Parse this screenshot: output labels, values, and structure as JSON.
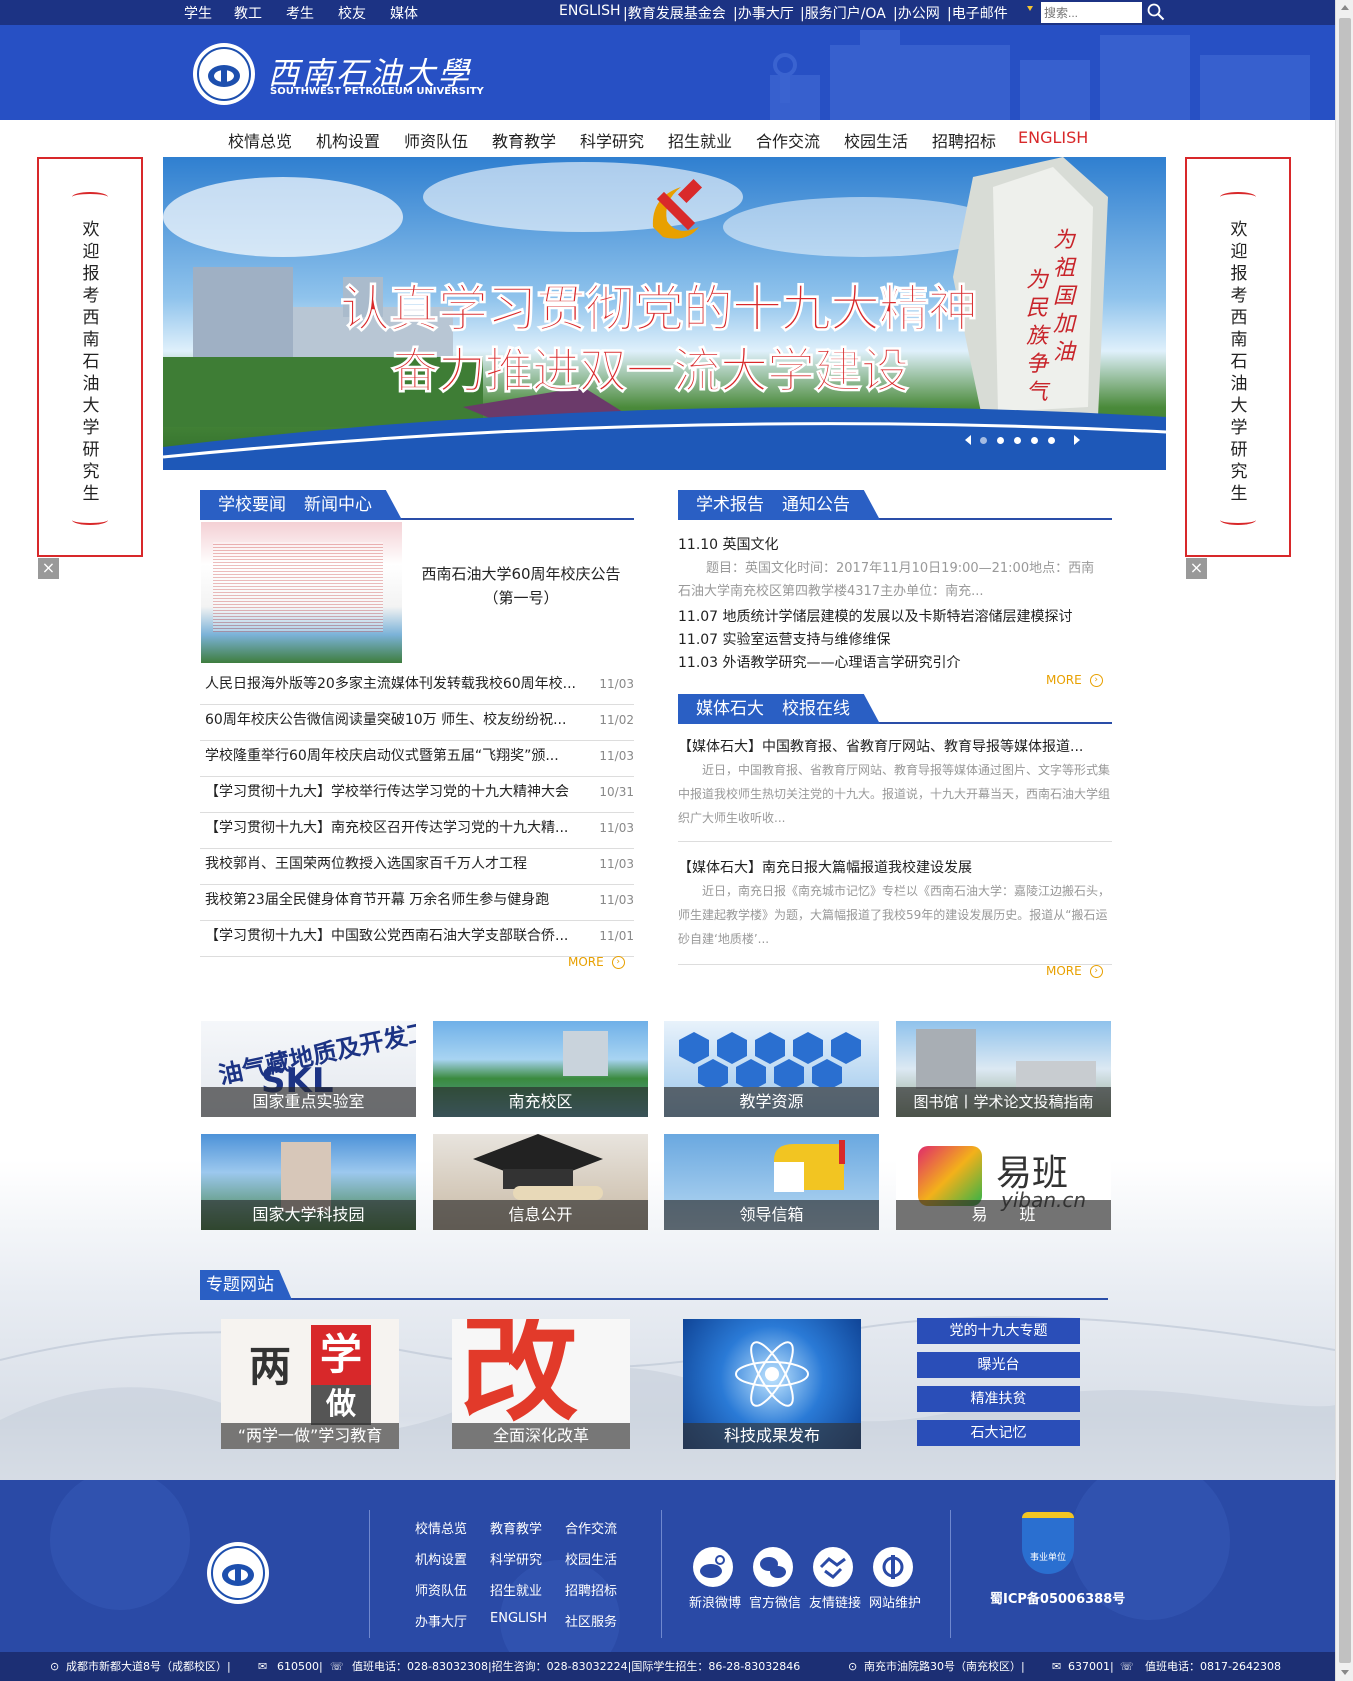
{
  "topbar": {
    "left_links": [
      "学生",
      "教工",
      "考生",
      "校友",
      "媒体"
    ],
    "right_links": [
      "ENGLISH",
      "|教育发展基金会",
      "|办事大厅",
      "|服务门户/OA",
      "|办公网",
      "|电子邮件"
    ],
    "search_placeholder": "搜索..."
  },
  "header": {
    "logo_cn": "西南石油大學",
    "logo_en": "SOUTHWEST PETROLEUM UNIVERSITY"
  },
  "nav": {
    "items": [
      "校情总览",
      "机构设置",
      "师资队伍",
      "教育教学",
      "科学研究",
      "招生就业",
      "合作交流",
      "校园生活",
      "招聘招标"
    ],
    "english": "ENGLISH"
  },
  "side_banner": {
    "text": "欢迎报考西南石油大学研究生",
    "close": "×"
  },
  "hero": {
    "line1": "认真学习贯彻党的十九大精神",
    "line2": "奋力推进双一流大学建设",
    "calligraphy": [
      "为祖国加油",
      "为民族争气"
    ]
  },
  "news": {
    "tab1": "学校要闻",
    "tab2": "新闻中心",
    "featured": "西南石油大学60周年校庆公告（第一号）",
    "more": "MORE",
    "items": [
      {
        "title": "人民日报海外版等20多家主流媒体刊发转载我校60周年校...",
        "date": "11/03"
      },
      {
        "title": "60周年校庆公告微信阅读量突破10万 师生、校友纷纷祝...",
        "date": "11/02"
      },
      {
        "title": "学校隆重举行60周年校庆启动仪式暨第五届“飞翔奖”颁...",
        "date": "11/03"
      },
      {
        "title": "【学习贯彻十九大】学校举行传达学习党的十九大精神大会",
        "date": "10/31"
      },
      {
        "title": "【学习贯彻十九大】南充校区召开传达学习党的十九大精...",
        "date": "11/03"
      },
      {
        "title": "我校郭肖、王国荣两位教授入选国家百千万人才工程",
        "date": "11/03"
      },
      {
        "title": "我校第23届全民健身体育节开幕 万余名师生参与健身跑",
        "date": "11/03"
      },
      {
        "title": "【学习贯彻十九大】中国致公党西南石油大学支部联合侨...",
        "date": "11/01"
      }
    ]
  },
  "notices": {
    "tab1": "学术报告",
    "tab2": "通知公告",
    "first": "11.10 英国文化",
    "first_desc": "题目：英国文化时间：2017年11月10日19:00—21:00地点：西南石油大学南充校区第四教学楼4317主办单位：南充...",
    "items": [
      "11.07 地质统计学储层建模的发展以及卡斯特岩溶储层建模探讨",
      "11.07 实验室运营支持与维修维保",
      "11.03 外语教学研究——心理语言学研究引介"
    ],
    "more": "MORE"
  },
  "media": {
    "tab1": "媒体石大",
    "tab2": "校报在线",
    "more": "MORE",
    "items": [
      {
        "title": "【媒体石大】中国教育报、省教育厅网站、教育导报等媒体报道...",
        "desc": "近日，中国教育报、省教育厅网站、教育导报等媒体通过图片、文字等形式集中报道我校师生热切关注党的十九大。报道说，十九大开幕当天，西南石油大学组织广大师生收听收..."
      },
      {
        "title": "【媒体石大】南充日报大篇幅报道我校建设发展",
        "desc": "近日，南充日报《南充城市记忆》专栏以《西南石油大学：嘉陵江边搬石头，师生建起教学楼》为题，大篇幅报道了我校59年的建设发展历史。报道从“搬石运砂自建‘地质楼’..."
      }
    ]
  },
  "tiles": [
    "国家重点实验室",
    "南充校区",
    "教学资源",
    "图书馆丨学术论文投稿指南",
    "国家大学科技园",
    "信息公开",
    "领导信箱",
    "易　　班"
  ],
  "tile_art": {
    "arc_text": "油气藏地质及开发工程",
    "skl": "SKL",
    "yiban": "易班",
    "yiban_url": "yiban.cn"
  },
  "special": {
    "title": "专题网站",
    "items": [
      "“两学一做”学习教育",
      "全面深化改革",
      "科技成果发布"
    ],
    "buttons": [
      "党的十九大专题",
      "曝光台",
      "精准扶贫",
      "石大记忆"
    ],
    "art": {
      "liang": "两",
      "xue": "学",
      "zuo": "做",
      "gai": "改"
    }
  },
  "footer": {
    "links": [
      "校情总览",
      "教育教学",
      "合作交流",
      "机构设置",
      "科学研究",
      "校园生活",
      "师资队伍",
      "招生就业",
      "招聘招标",
      "办事大厅",
      "ENGLISH",
      "社区服务"
    ],
    "social": [
      "新浪微博",
      "官方微信",
      "友情链接",
      "网站维护"
    ],
    "badge": "事业单位",
    "icp": "蜀ICP备05006388号"
  },
  "bottombar": {
    "text1": "成都市新都大道8号（成都校区）|",
    "text2": "610500|",
    "text3": "值班电话：028-83032308|招生咨询：028-83032224|国际学生招生：86-28-83032846",
    "text4": "南充市油院路30号（南充校区）|",
    "text5": "637001|",
    "text6": "值班电话：0817-2642308"
  }
}
